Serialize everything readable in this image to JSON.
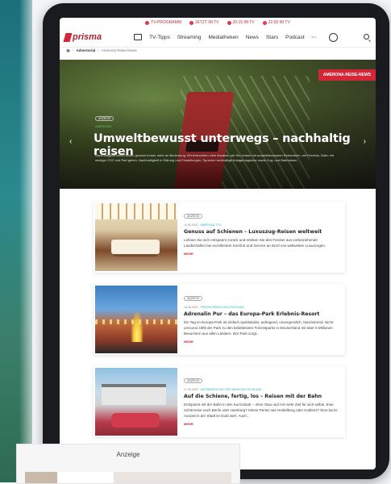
{
  "tv_bar": [
    "TV-PROGRAMM",
    "JETZT IM TV",
    "20:15 IM TV",
    "22:00 IM TV"
  ],
  "brand": {
    "logo": "prisma",
    "accent": "#d32638"
  },
  "nav": {
    "items": [
      "TV-Tipps",
      "Streaming",
      "Mediatheken",
      "News",
      "Stars",
      "Podcast"
    ],
    "more": "···"
  },
  "breadcrumb": [
    "Advertorial",
    "Amerona Reise-News"
  ],
  "hero": {
    "badge": "AMERONA-REISE-NEWS",
    "tag": "ANZEIGE",
    "category": "AMERONA",
    "title": "Umweltbewusst unterwegs – nachhaltig reisen",
    "text": "Nachhaltigkeit beim Reisen gewinnt immer mehr an Bedeutung. Wir beleuchten viele Ansätze, wie Sie Urlaub mit umweltbewussten Reisezielen, mit Fernbus, Bahn mit weniger CO2 und Rad gehen. Nachhaltigkeit in Klärung und Einstellungen, Sprache nachhaltige Anlagemagazine sowie Zug- und Bahnreisen."
  },
  "articles": [
    {
      "tag": "ANZEIGE",
      "date": "19.08.2023",
      "category": "AMERONA-TTS",
      "title": "Genuss auf Schienen – Luxuszug-Reisen weltweit",
      "text": "Lehnen Sie sich entspannt zurück und erleben Sie den Fenster aus vorbeiziehende Landschaften bei exzellentem Komfort und Service an Bord von weltweiten Luxuszugen.",
      "more": "MEHR"
    },
    {
      "tag": "ANZEIGE",
      "date": "18.08.2023",
      "category": "FREIZEITPARKS DEUTSCHLAND",
      "title": "Adrenalin Pur – das Europa-Park Erlebnis-Resort",
      "text": "Ein Tag im Europa-Park ist einfach spektakulär, aufregend, unvergesslich, faszinierend. Nicht umsonst zählt der Park zu den beliebtesten Freizeitparks in Deutschland mit über 5 Millionen Besuchern aus allen Ländern. Der Park sorgt...",
      "more": "MEHR"
    },
    {
      "tag": "ANZEIGE",
      "date": "17.08.2023",
      "category": "UNTERWEGS MIT DER BAHN DEUTSCHLAND",
      "title": "Auf die Schiene, fertig, los – Reisen mit der Bahn",
      "text": "Entspannt mit der Bahn in den Kurzurlaub – ohne Stau und mit mehr Zeit für sich selbst. Eine Schönreise nach Berlin oder Hamburg? Kleine Perlen wie Heidelberg oder Koblenz? Eine kurze Auszeit in der Stadt ist Gold wert. Auch...",
      "more": "MEHR"
    }
  ],
  "ad": {
    "label": "Anzeige"
  }
}
